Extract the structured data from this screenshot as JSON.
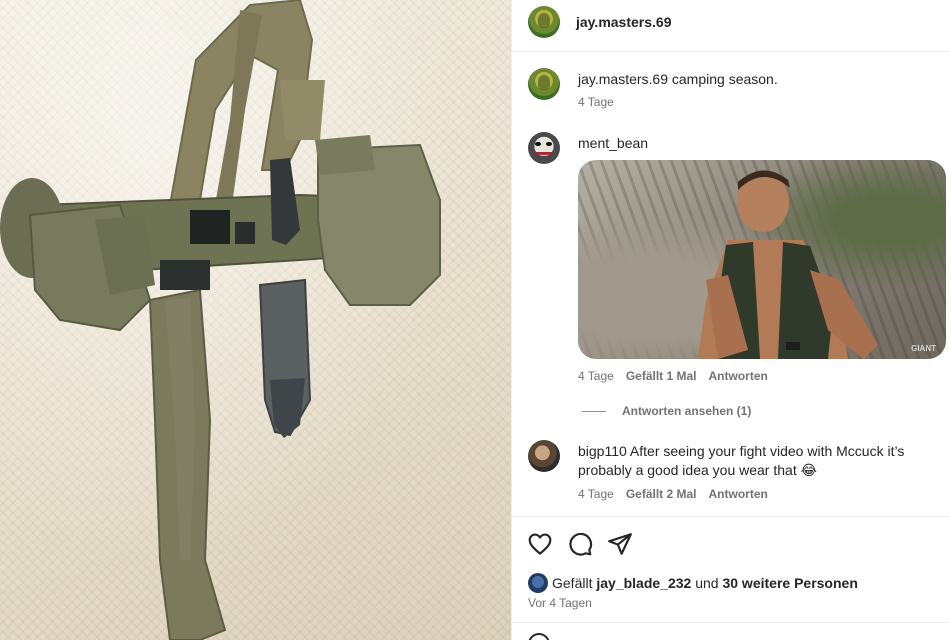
{
  "post": {
    "author": "jay.masters.69",
    "caption": "camping season.",
    "caption_time": "4 Tage"
  },
  "comments": [
    {
      "user": "ment_bean",
      "text": "",
      "time": "4 Tage",
      "likes": "Gefällt 1 Mal",
      "reply": "Antworten",
      "has_gif": true,
      "gif_watermark": "GIANT"
    },
    {
      "user": "bigp110",
      "text": "After seeing your fight video with Mccuck it’s probably a good idea you wear that 😂",
      "time": "4 Tage",
      "likes": "Gefällt 2 Mal",
      "reply": "Antworten"
    }
  ],
  "view_replies": "Antworten ansehen (1)",
  "likes_summary": {
    "prefix": "Gefällt",
    "first_user": "jay_blade_232",
    "connector": "und",
    "others": "30 weitere Personen"
  },
  "post_time": "Vor 4 Tagen",
  "icons": {
    "like": "heart-icon",
    "comment": "comment-icon",
    "share": "send-icon"
  },
  "colors": {
    "text": "#262626",
    "secondary": "#737373",
    "divider": "#efefef"
  }
}
